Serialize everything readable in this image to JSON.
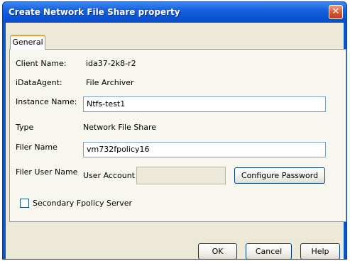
{
  "window": {
    "title": "Create Network File Share property",
    "close_glyph": "✕"
  },
  "tabs": [
    {
      "label": "General",
      "selected": true
    }
  ],
  "form": {
    "client_name_label": "Client Name:",
    "client_name_value": "ida37-2k8-r2",
    "idataagent_label": "iDataAgent:",
    "idataagent_value": "File Archiver",
    "instance_name_label": "Instance Name:",
    "instance_name_value": "Ntfs-test1",
    "type_label": "Type",
    "type_value": "Network File Share",
    "filer_name_label": "Filer Name",
    "filer_name_value": "vm732fpolicy16",
    "filer_user_name_label": "Filer User Name",
    "user_account_label": "User Account",
    "user_account_value": "",
    "configure_password_label": "Configure Password",
    "secondary_fpolicy_label": "Secondary Fpolicy Server",
    "secondary_fpolicy_checked": false
  },
  "buttons": {
    "ok_label": "OK",
    "cancel_label": "Cancel",
    "help_label": "Help"
  },
  "colors": {
    "titlebar": "#0b55d6",
    "dialog_bg": "#ece9d8",
    "close_button": "#d8502c"
  }
}
